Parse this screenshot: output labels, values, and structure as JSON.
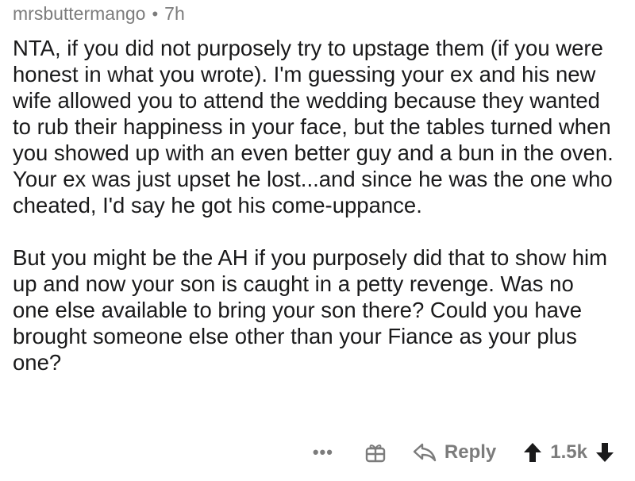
{
  "comment": {
    "author": "mrsbuttermango",
    "separator": "•",
    "age": "7h",
    "paragraphs": [
      "NTA, if you did not purposely try to upstage them (if you were honest in what you wrote). I'm guessing your ex and his new wife allowed you to attend the wedding because they wanted to rub their happiness in your face, but the tables turned when you showed up with an even better guy and a bun in the oven. Your ex was just upset he lost...and since he was the one who cheated, I'd say he got his come-uppance.",
      "But you might be the AH if you purposely did that to show him up and now your son is caught in a petty revenge. Was no one else available to bring your son there? Could you have brought someone else other than your Fiance as your plus one?"
    ]
  },
  "actions": {
    "more_label": "•••",
    "gift_icon": "gift-icon",
    "reply_icon": "reply-arrow-icon",
    "reply_label": "Reply",
    "upvote_icon": "upvote-arrow-icon",
    "score": "1.5k",
    "downvote_icon": "downvote-arrow-icon"
  },
  "colors": {
    "text": "#1a1a1b",
    "muted": "#7c7c7c",
    "background": "#ffffff"
  }
}
